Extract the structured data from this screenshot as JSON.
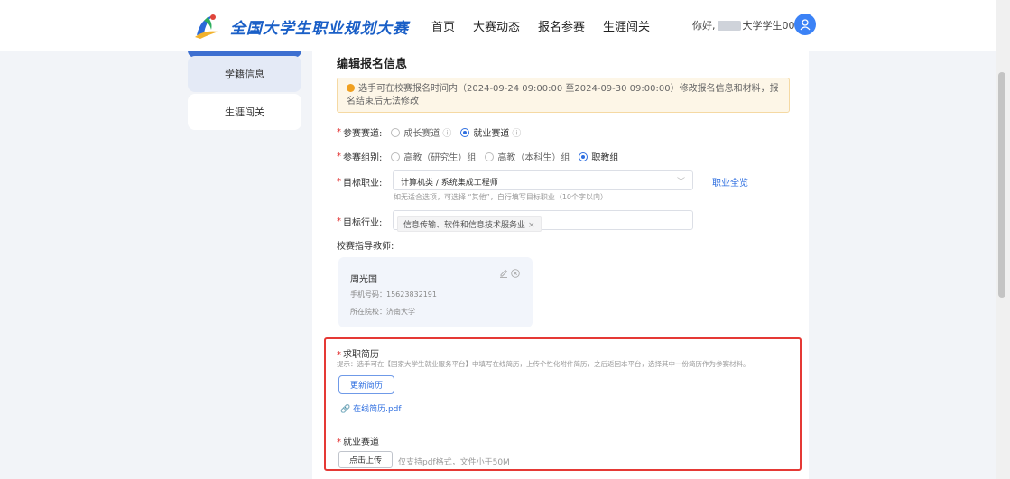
{
  "header": {
    "logo_text": "全国大学生职业规划大赛",
    "nav": [
      "首页",
      "大赛动态",
      "报名参赛",
      "生涯闯关"
    ],
    "greeting_prefix": "你好,",
    "greeting_user": "大学学生0001"
  },
  "sidebar": {
    "items": [
      {
        "label": "学籍信息",
        "active": true
      },
      {
        "label": "生涯闯关",
        "active": false
      }
    ]
  },
  "form": {
    "title": "编辑报名信息",
    "notice": "选手可在校赛报名时间内（2024-09-24 09:00:00 至2024-09-30 09:00:00）修改报名信息和材料，报名结束后无法修改",
    "track": {
      "label": "参赛赛道:",
      "options": [
        {
          "label": "成长赛道",
          "selected": false
        },
        {
          "label": "就业赛道",
          "selected": true
        }
      ]
    },
    "group": {
      "label": "参赛组别:",
      "options": [
        {
          "label": "高教（研究生）组",
          "selected": false
        },
        {
          "label": "高教（本科生）组",
          "selected": false
        },
        {
          "label": "职教组",
          "selected": true
        }
      ]
    },
    "target_job": {
      "label": "目标职业:",
      "value": "计算机类 / 系统集成工程师",
      "link": "职业全览",
      "hint": "如无适合选项，可选择 “其他”，自行填写目标职业（10个字以内）"
    },
    "target_industry": {
      "label": "目标行业:",
      "tag": "信息传输、软件和信息技术服务业"
    },
    "teacher": {
      "label": "校赛指导教师:",
      "name": "周光国",
      "phone": "手机号码：15623832191",
      "school": "所在院校：济南大学"
    },
    "resume": {
      "title": "求职简历",
      "hint": "提示：选手可在【国家大学生就业服务平台】中填写在线简历，上传个性化附件简历，之后返回本平台，选择其中一份简历作为参赛材料。",
      "update_button": "更新简历",
      "file": "在线简历.pdf"
    },
    "employment_track": {
      "title": "就业赛道",
      "upload_button": "点击上传",
      "upload_hint": "仅支持pdf格式，文件小于50M"
    }
  },
  "colors": {
    "primary": "#2f6fe0",
    "required": "#e02424",
    "highlight_border": "#e53935",
    "notice_bg": "#fdf6e7"
  }
}
